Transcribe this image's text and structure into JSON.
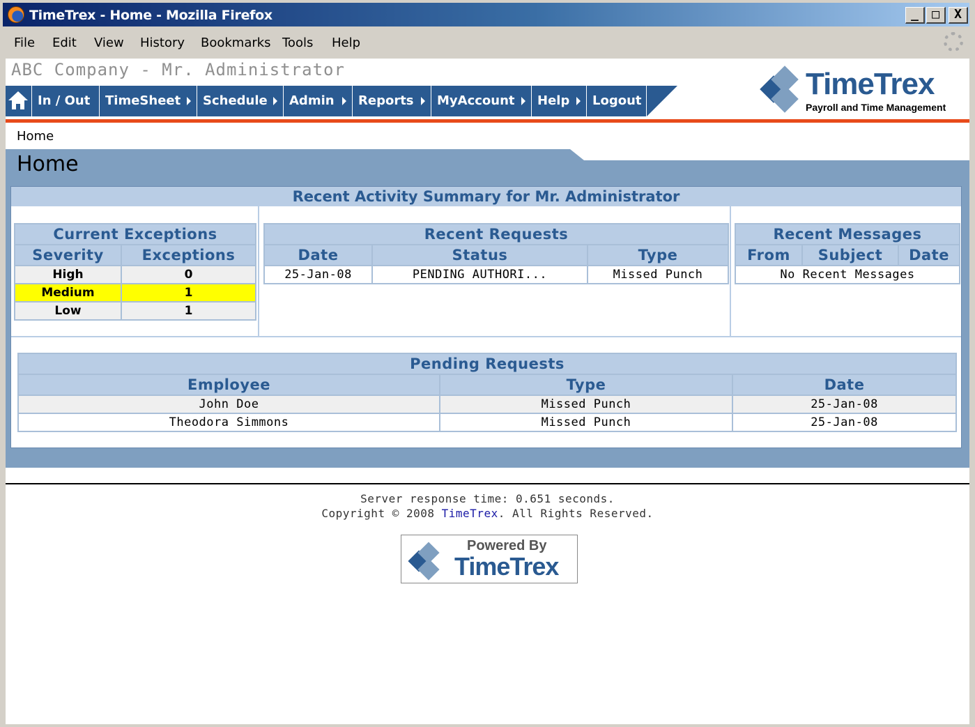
{
  "window": {
    "title": "TimeTrex - Home - Mozilla Firefox",
    "min": "_",
    "max": "□",
    "close": "X"
  },
  "menubar": {
    "items": [
      "File",
      "Edit",
      "View",
      "History",
      "Bookmarks",
      "Tools",
      "Help"
    ]
  },
  "header": {
    "company": "ABC Company - Mr. Administrator",
    "logo_title": "TimeTrex",
    "logo_subtitle": "Payroll and Time Management"
  },
  "nav": {
    "items": [
      "In / Out",
      "TimeSheet",
      "Schedule",
      "Admin",
      "Reports",
      "MyAccount",
      "Help",
      "Logout"
    ]
  },
  "breadcrumb": "Home",
  "page_title": "Home",
  "summary": {
    "title": "Recent Activity Summary for Mr. Administrator",
    "exceptions": {
      "title": "Current Exceptions",
      "columns": [
        "Severity",
        "Exceptions"
      ],
      "rows": [
        {
          "severity": "High",
          "count": "0"
        },
        {
          "severity": "Medium",
          "count": "1"
        },
        {
          "severity": "Low",
          "count": "1"
        }
      ]
    },
    "requests": {
      "title": "Recent Requests",
      "columns": [
        "Date",
        "Status",
        "Type"
      ],
      "rows": [
        {
          "date": "25-Jan-08",
          "status": "PENDING AUTHORI...",
          "type": "Missed Punch"
        }
      ]
    },
    "messages": {
      "title": "Recent Messages",
      "columns": [
        "From",
        "Subject",
        "Date"
      ],
      "empty": "No Recent Messages"
    }
  },
  "pending": {
    "title": "Pending Requests",
    "columns": [
      "Employee",
      "Type",
      "Date"
    ],
    "rows": [
      {
        "employee": "John Doe",
        "type": "Missed Punch",
        "date": "25-Jan-08"
      },
      {
        "employee": "Theodora Simmons",
        "type": "Missed Punch",
        "date": "25-Jan-08"
      }
    ]
  },
  "footer": {
    "response": "Server response time: 0.651 seconds.",
    "copyright_prefix": "Copyright © 2008 ",
    "copyright_link": "TimeTrex",
    "copyright_suffix": ". All Rights Reserved.",
    "powered_by": "Powered By",
    "powered_name": "TimeTrex"
  },
  "colors": {
    "nav": "#2a5a91",
    "accent_rule": "#e84a1a",
    "panel": "#7f9fc0",
    "header_cell": "#b9cde5",
    "medium_highlight": "#ffff00"
  },
  "icons": {
    "home": "home-icon",
    "browser": "firefox-icon",
    "throbber": "throbber-icon",
    "logo": "timetrex-logo-icon"
  }
}
